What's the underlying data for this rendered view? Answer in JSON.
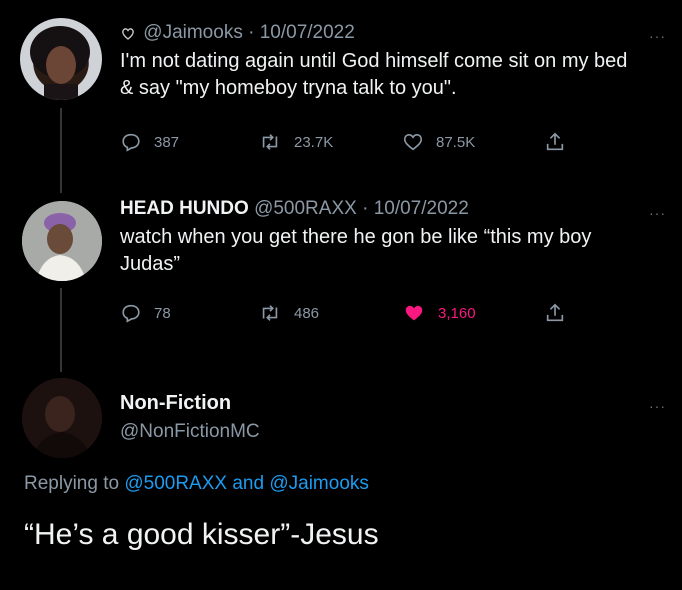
{
  "tweet1": {
    "handle": "@Jaimooks",
    "sep": "·",
    "date": "10/07/2022",
    "text": "I'm not dating again until God himself come sit on my bed & say \"my homeboy tryna talk to you\".",
    "replies": "387",
    "retweets": "23.7K",
    "likes": "87.5K",
    "more": "···"
  },
  "tweet2": {
    "name": "HEAD HUNDO",
    "handle": "@500RAXX",
    "sep": "·",
    "date": "10/07/2022",
    "text": "watch when you get there he gon be like “this my boy Judas”",
    "replies": "78",
    "retweets": "486",
    "likes": "3,160",
    "more": "···"
  },
  "tweet3": {
    "name": "Non-Fiction",
    "handle": "@NonFictionMC",
    "replying_prefix": "Replying to",
    "replying_user1": "@500RAXX",
    "replying_and": "and",
    "replying_user2": "@Jaimooks",
    "text": "“He’s a good kisser”-Jesus",
    "more": "···"
  },
  "colors": {
    "like_active": "#f91880",
    "link": "#1d9bf0",
    "muted": "#8b98a5"
  }
}
